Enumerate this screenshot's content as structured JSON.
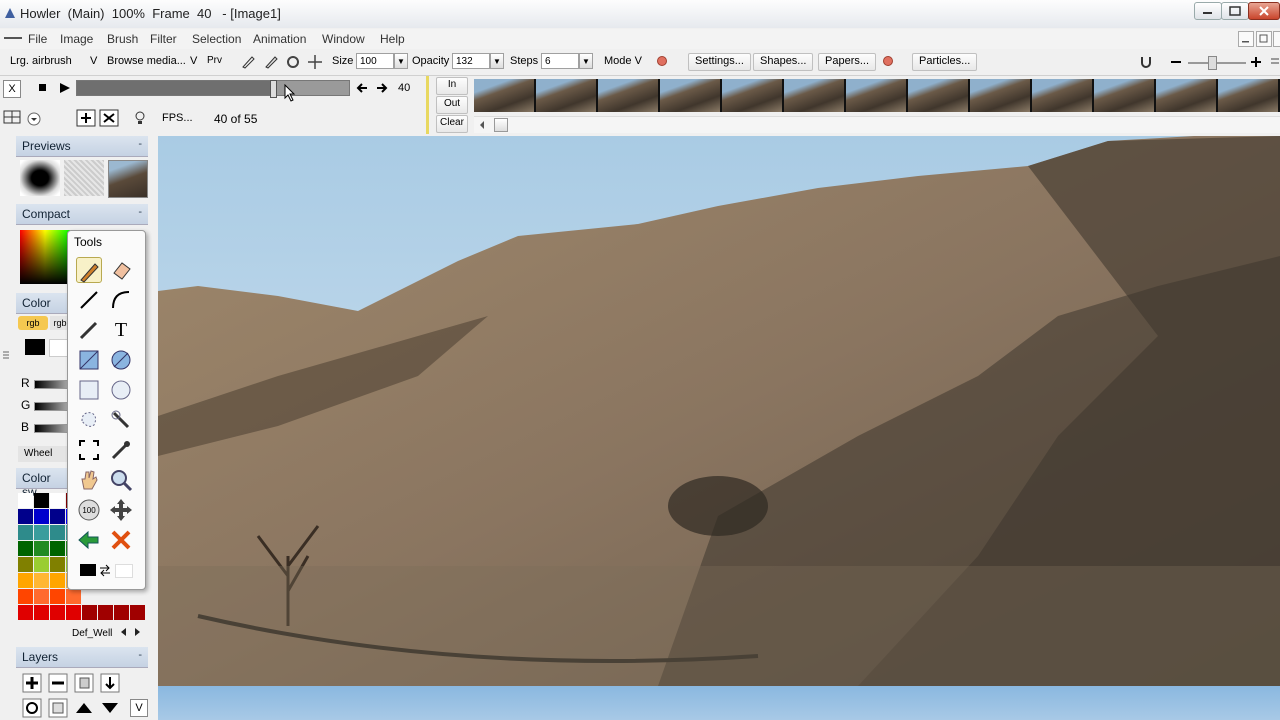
{
  "window": {
    "title": "Howler  (Main)  100%  Frame  40   - [Image1]"
  },
  "menubar": {
    "items": [
      "File",
      "Image",
      "Brush",
      "Filter",
      "Selection",
      "Animation",
      "Window",
      "Help"
    ]
  },
  "toolbar": {
    "brush_name": "Lrg. airbrush",
    "v1": "V",
    "browse_media": "Browse media...",
    "v2": "V",
    "prv": "Prv",
    "size_label": "Size",
    "size_value": "100",
    "opacity_label": "Opacity",
    "opacity_value": "132",
    "steps_label": "Steps",
    "steps_value": "6",
    "mode_label": "Mode V",
    "settings": "Settings...",
    "shapes": "Shapes...",
    "papers": "Papers...",
    "particles": "Particles..."
  },
  "animation": {
    "x_label": "X",
    "current_frame": "40",
    "progress": 0.72,
    "fps": "FPS...",
    "frame_counter": "40 of 55",
    "in": "In",
    "out": "Out",
    "clear": "Clear"
  },
  "panels": {
    "previews": "Previews",
    "compact": "Compact",
    "color": "Color",
    "rgb1": "rgb",
    "rgb2": "rgb",
    "r": "R",
    "g": "G",
    "b": "B",
    "wheel": "Wheel",
    "color_swatches": "Color sw",
    "def_well": "Def_Well",
    "layers": "Layers",
    "layers_v": "V",
    "collapse": "-"
  },
  "tools": {
    "title": "Tools",
    "zoom_badge": "100",
    "text_tool": "T"
  },
  "colors": {
    "accent": "#c5d2e3",
    "sky": "#bcd6ea",
    "hills": "#8a7560",
    "swatches": [
      "#ffffff",
      "#000000",
      "#ffffff",
      "#800000",
      "#00008b",
      "#0000cd",
      "#00008b",
      "#0000ff",
      "#2e8b8b",
      "#3a9d9d",
      "#2e8b8b",
      "#3a9d9d",
      "#006400",
      "#228b22",
      "#006400",
      "#228b22",
      "#808000",
      "#9acd32",
      "#808000",
      "#9acd32",
      "#ffa500",
      "#ffb733",
      "#ffa500",
      "#ffb733",
      "#ff4500",
      "#ff6a2e",
      "#ff4500",
      "#ff6a2e",
      "#cc0000",
      "#e00000",
      "#b30000",
      "#990000"
    ]
  }
}
